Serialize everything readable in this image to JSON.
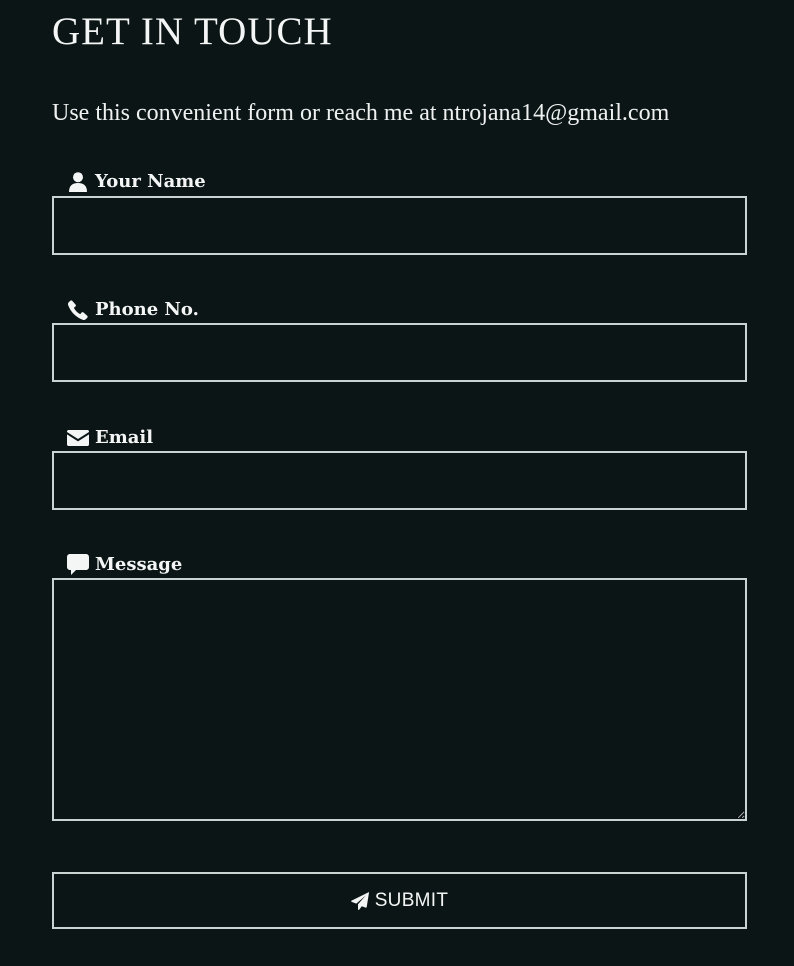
{
  "page": {
    "title": "GET IN TOUCH",
    "intro": "Use this convenient form or reach me at ntrojana14@gmail.com"
  },
  "form": {
    "fields": [
      {
        "label": "Your Name",
        "icon": "user-icon",
        "value": "",
        "placeholder": ""
      },
      {
        "label": "Phone No.",
        "icon": "phone-icon",
        "value": "",
        "placeholder": ""
      },
      {
        "label": "Email",
        "icon": "envelope-icon",
        "value": "",
        "placeholder": ""
      },
      {
        "label": "Message",
        "icon": "comment-icon",
        "value": "",
        "placeholder": ""
      }
    ],
    "submit": {
      "label": "SUBMIT",
      "icon": "paper-plane-icon"
    }
  },
  "colors": {
    "background": "#0b1516",
    "text": "#f2f4f3",
    "border": "#c9d3d1"
  }
}
